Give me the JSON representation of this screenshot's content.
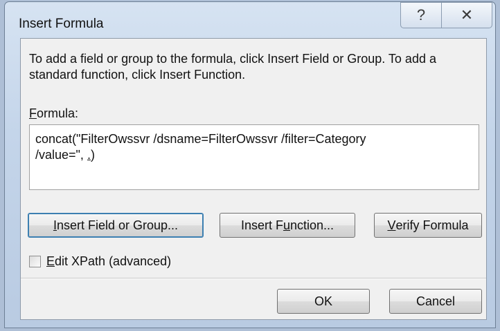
{
  "window": {
    "title": "Insert Formula",
    "help_icon": "?",
    "close_icon": "✕"
  },
  "dialog": {
    "instructions": "To add a field or group to the formula, click Insert Field or Group. To add a standard function, click Insert Function.",
    "formula_label_mnemonic": "F",
    "formula_label_rest": "ormula:",
    "formula_value_line1": "concat(\"FilterOwssvr /dsname=FilterOwssvr /filter=Category",
    "formula_value_line2_before": "/value=\", ",
    "formula_value_line2_underlined": ".",
    "formula_value_line2_after": ")",
    "buttons": {
      "insert_field_mnemonic": "I",
      "insert_field_rest": "nsert Field or Group...",
      "insert_function_before": "Insert F",
      "insert_function_mnemonic": "u",
      "insert_function_after": "nction...",
      "verify_mnemonic": "V",
      "verify_rest": "erify Formula",
      "ok": "OK",
      "cancel": "Cancel"
    },
    "edit_xpath_mnemonic": "E",
    "edit_xpath_rest": "dit XPath (advanced)",
    "edit_xpath_checked": false
  }
}
